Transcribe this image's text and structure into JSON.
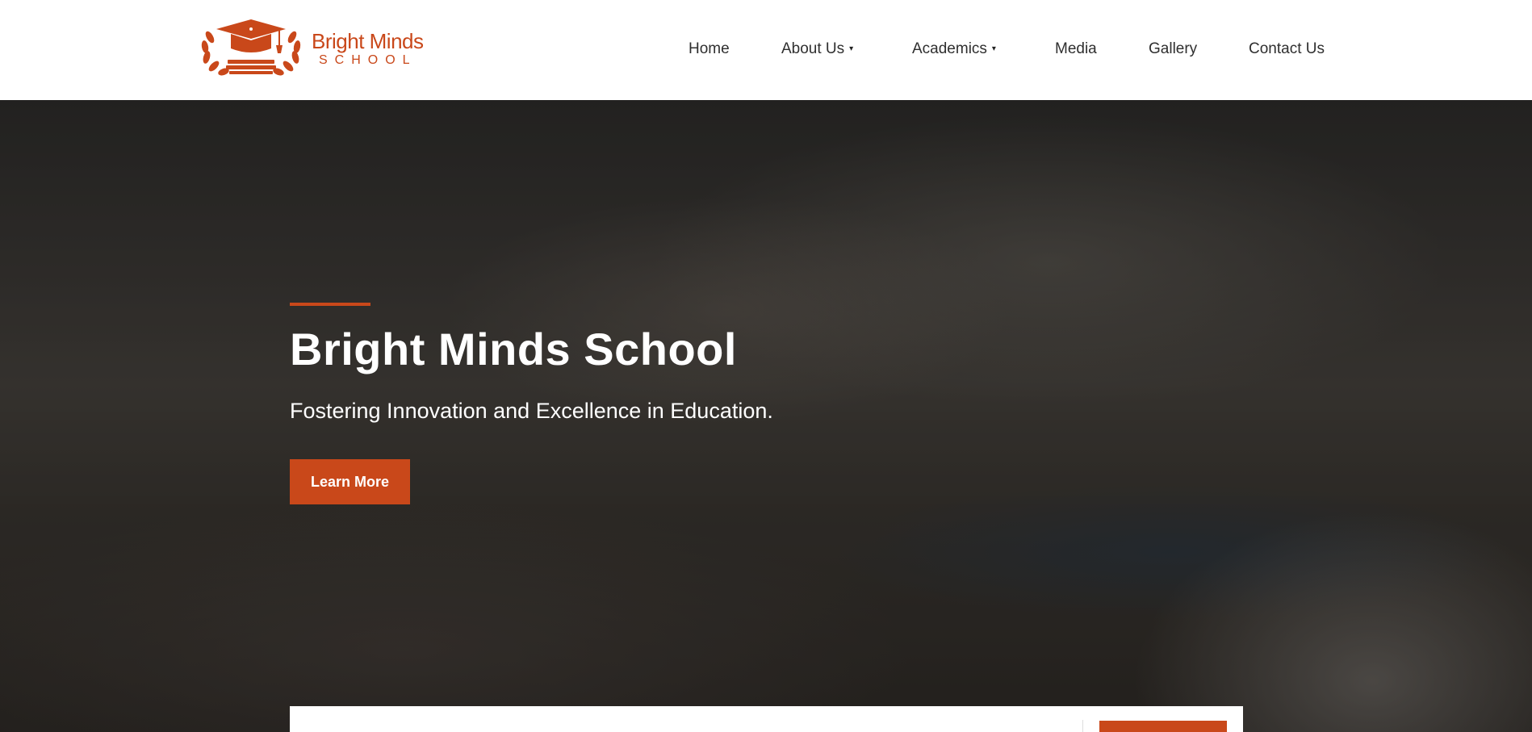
{
  "logo": {
    "name": "Bright Minds",
    "sub": "SCHOOL",
    "brand_color": "#c9481a",
    "icon": "graduation-cap-laurel-icon"
  },
  "nav": {
    "items": [
      {
        "label": "Home",
        "has_dropdown": false
      },
      {
        "label": "About Us",
        "has_dropdown": true
      },
      {
        "label": "Academics",
        "has_dropdown": true
      },
      {
        "label": "Media",
        "has_dropdown": false
      },
      {
        "label": "Gallery",
        "has_dropdown": false
      },
      {
        "label": "Contact Us",
        "has_dropdown": false
      }
    ],
    "caret": "▾"
  },
  "hero": {
    "title": "Bright Minds School",
    "subtitle": "Fostering Innovation and Excellence in Education.",
    "button_label": "Learn More",
    "accent_color": "#c9481a"
  }
}
